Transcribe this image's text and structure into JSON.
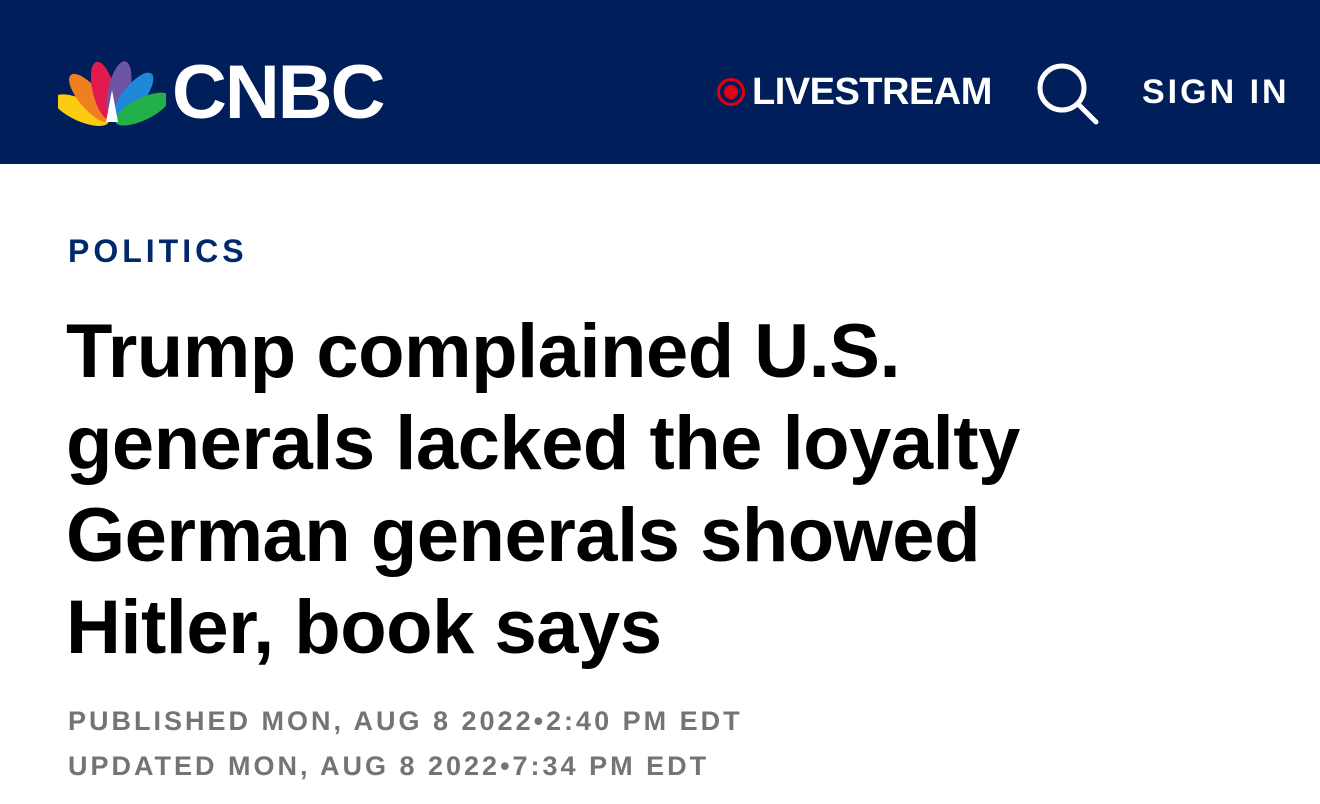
{
  "header": {
    "logo_text": "CNBC",
    "livestream_label": "LIVESTREAM",
    "signin_label": "SIGN IN",
    "background_color": "#001e5a",
    "live_dot_color": "#e3000f"
  },
  "article": {
    "section": "POLITICS",
    "headline": "Trump complained U.S. generals lacked the loyalty German generals showed Hitler, book says",
    "published": "PUBLISHED MON, AUG 8 2022•2:40 PM EDT",
    "updated": "UPDATED MON, AUG 8 2022•7:34 PM EDT"
  },
  "icons": {
    "logo": "nbc-peacock-icon",
    "live": "live-dot-icon",
    "search": "search-icon"
  }
}
